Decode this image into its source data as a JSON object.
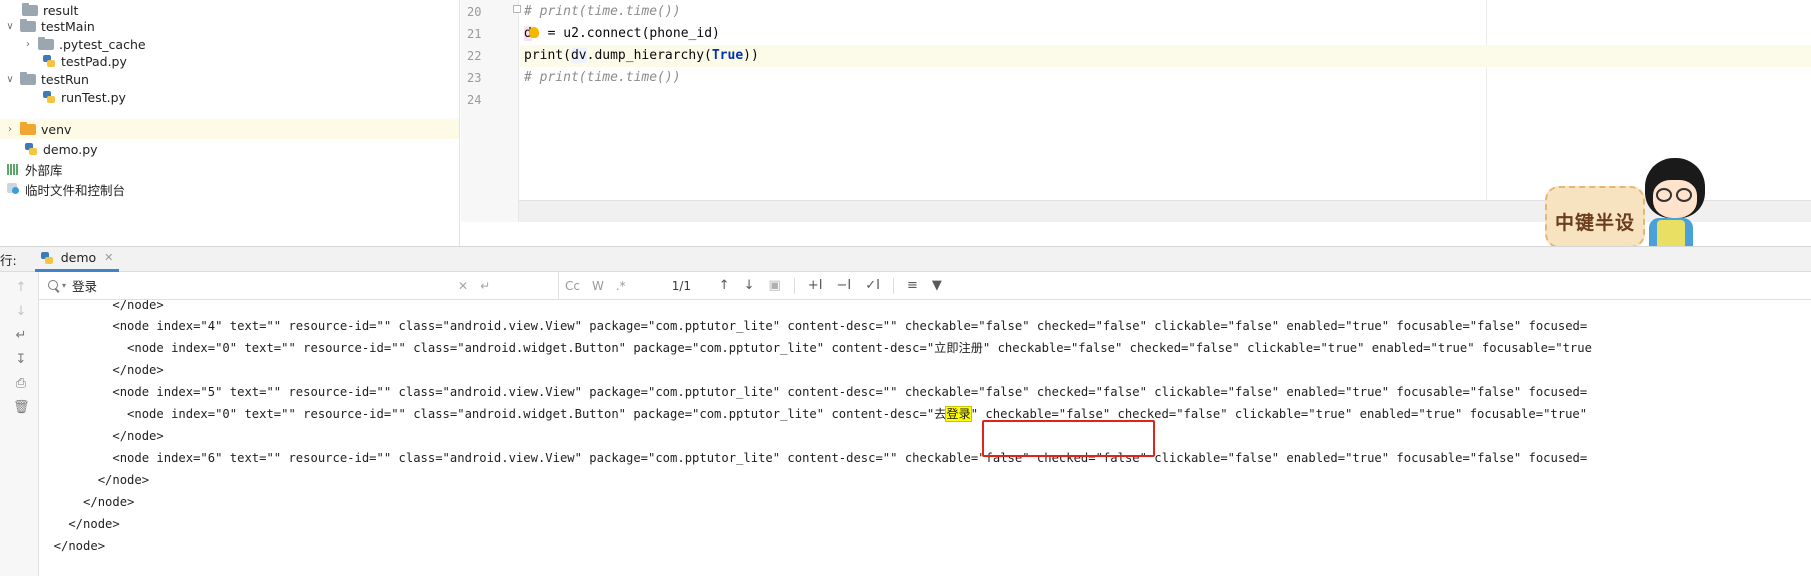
{
  "project_tree": {
    "items": [
      {
        "label": "result",
        "icon": "folder-icon",
        "indent": 1,
        "expanded": null
      },
      {
        "label": "testMain",
        "icon": "folder-icon",
        "indent": 0,
        "expanded": true
      },
      {
        "label": ".pytest_cache",
        "icon": "folder-icon",
        "indent": 1,
        "expanded": false
      },
      {
        "label": "testPad.py",
        "icon": "python-file-icon",
        "indent": 2,
        "expanded": null
      },
      {
        "label": "testRun",
        "icon": "folder-icon",
        "indent": 0,
        "expanded": true
      },
      {
        "label": "runTest.py",
        "icon": "python-file-icon",
        "indent": 2,
        "expanded": null
      },
      {
        "label": "venv",
        "icon": "folder-orange-icon",
        "indent": 0,
        "expanded": false
      },
      {
        "label": "demo.py",
        "icon": "python-file-icon",
        "indent": 1,
        "expanded": null
      },
      {
        "label": "外部库",
        "icon": "library-icon",
        "indent": 0,
        "expanded": null
      },
      {
        "label": "临时文件和控制台",
        "icon": "scratch-icon",
        "indent": 0,
        "expanded": null
      }
    ]
  },
  "editor": {
    "lines": [
      {
        "num": "20",
        "code": "# print(time.time())"
      },
      {
        "num": "21",
        "code": "dv = u2.connect(phone_id)"
      },
      {
        "num": "22",
        "code": "print(dv.dump_hierarchy(True))"
      },
      {
        "num": "23",
        "code": "# print(time.time())"
      },
      {
        "num": "24",
        "code": ""
      }
    ],
    "line21_prefix": "d",
    "line21_rest": " = u2.connect(phone_id)",
    "line22_pre": "print(",
    "line22_dv": "dv",
    "line22_mid": ".dump_hierarchy(",
    "line22_kw": "True",
    "line22_post": "))"
  },
  "watermark": {
    "text": "中键半设"
  },
  "run_panel": {
    "label": "行:",
    "tab_label": "demo"
  },
  "find_bar": {
    "query": "登录",
    "match_count": "1/1",
    "case_btn": "Cc",
    "word_btn": "W",
    "regex_btn": ".*"
  },
  "console": {
    "lines": [
      "          </node>",
      "          <node index=\"4\" text=\"\" resource-id=\"\" class=\"android.view.View\" package=\"com.pptutor_lite\" content-desc=\"\" checkable=\"false\" checked=\"false\" clickable=\"false\" enabled=\"true\" focusable=\"false\" focused=",
      "            <node index=\"0\" text=\"\" resource-id=\"\" class=\"android.widget.Button\" package=\"com.pptutor_lite\" content-desc=\"立即注册\" checkable=\"false\" checked=\"false\" clickable=\"true\" enabled=\"true\" focusable=\"true",
      "          </node>",
      "          <node index=\"5\" text=\"\" resource-id=\"\" class=\"android.view.View\" package=\"com.pptutor_lite\" content-desc=\"\" checkable=\"false\" checked=\"false\" clickable=\"false\" enabled=\"true\" focusable=\"false\" focused=",
      "",
      "          </node>",
      "          <node index=\"6\" text=\"\" resource-id=\"\" class=\"android.view.View\" package=\"com.pptutor_lite\" content-desc=\"\" checkable=\"false\" checked=\"false\" clickable=\"false\" enabled=\"true\" focusable=\"false\" focused=",
      "        </node>",
      "      </node>",
      "    </node>",
      "  </node>"
    ],
    "match_line_pre": "            <node index=\"0\" text=\"\" resource-id=\"\" class=\"android.widget.Button\" package=\"com.pptutor_lite\" content-desc=\"去",
    "match_line_hit": "登录",
    "match_line_post": "\" checkable=\"false\" checked=\"false\" clickable=\"true\" enabled=\"true\" focusable=\"true\" "
  },
  "colors": {
    "accent": "#4083c9",
    "highlight": "#ffff00",
    "annotation_box": "#e2231a",
    "current_line": "#fcfae8"
  }
}
